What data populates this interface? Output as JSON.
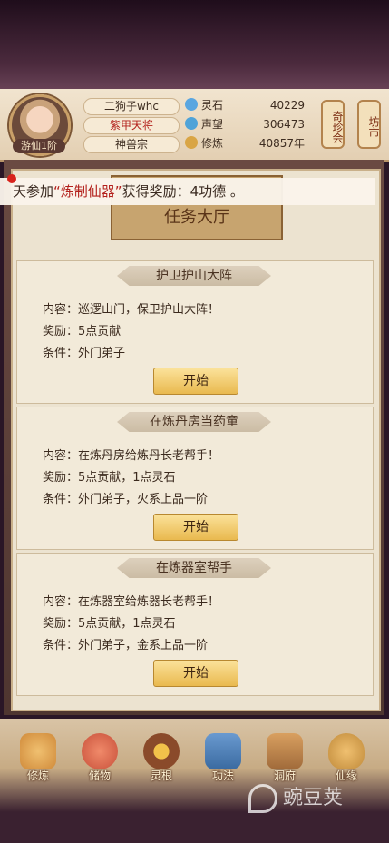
{
  "player": {
    "name": "二狗子whc",
    "title": "紫甲天将",
    "sect": "神兽宗",
    "rank": "游仙1阶"
  },
  "stats": [
    {
      "label": "灵石",
      "value": "40229",
      "icon": "spirit-stone-icon",
      "color": "#5aa6e0"
    },
    {
      "label": "声望",
      "value": "306473",
      "icon": "prestige-icon",
      "color": "#4fa3d8"
    },
    {
      "label": "修炼",
      "value": "40857年",
      "icon": "meditation-icon",
      "color": "#d9a545"
    }
  ],
  "side_buttons": {
    "treasure": "奇珍会",
    "market": "坊市"
  },
  "ticker": {
    "prefix": "天参加",
    "highlight": "“炼制仙器”",
    "suffix": "获得奖励：4功德 。"
  },
  "hall_sign": "任务大厅",
  "tasks": [
    {
      "title": "护卫护山大阵",
      "content": "内容：巡逻山门，保卫护山大阵！",
      "reward": "奖励：5点贡献",
      "condition": "条件：外门弟子",
      "button": "开始"
    },
    {
      "title": "在炼丹房当药童",
      "content": "内容：在炼丹房给炼丹长老帮手！",
      "reward": "奖励：5点贡献，1点灵石",
      "condition": "条件：外门弟子，火系上品一阶",
      "button": "开始"
    },
    {
      "title": "在炼器室帮手",
      "content": "内容：在炼器室给炼器长老帮手！",
      "reward": "奖励：5点贡献，1点灵石",
      "condition": "条件：外门弟子，金系上品一阶",
      "button": "开始"
    }
  ],
  "nav": [
    {
      "label": "修炼",
      "icon": "cultivate-icon",
      "color": "#d08a3a"
    },
    {
      "label": "储物",
      "icon": "storage-bag-icon",
      "color": "#c8503a"
    },
    {
      "label": "灵根",
      "icon": "spirit-root-icon",
      "color": "#8a4a2a"
    },
    {
      "label": "功法",
      "icon": "technique-book-icon",
      "color": "#3a6aa0"
    },
    {
      "label": "洞府",
      "icon": "cave-house-icon",
      "color": "#a06a3a"
    },
    {
      "label": "仙缘",
      "icon": "gourd-icon",
      "color": "#c08a3a"
    }
  ],
  "watermark": "豌豆荚"
}
